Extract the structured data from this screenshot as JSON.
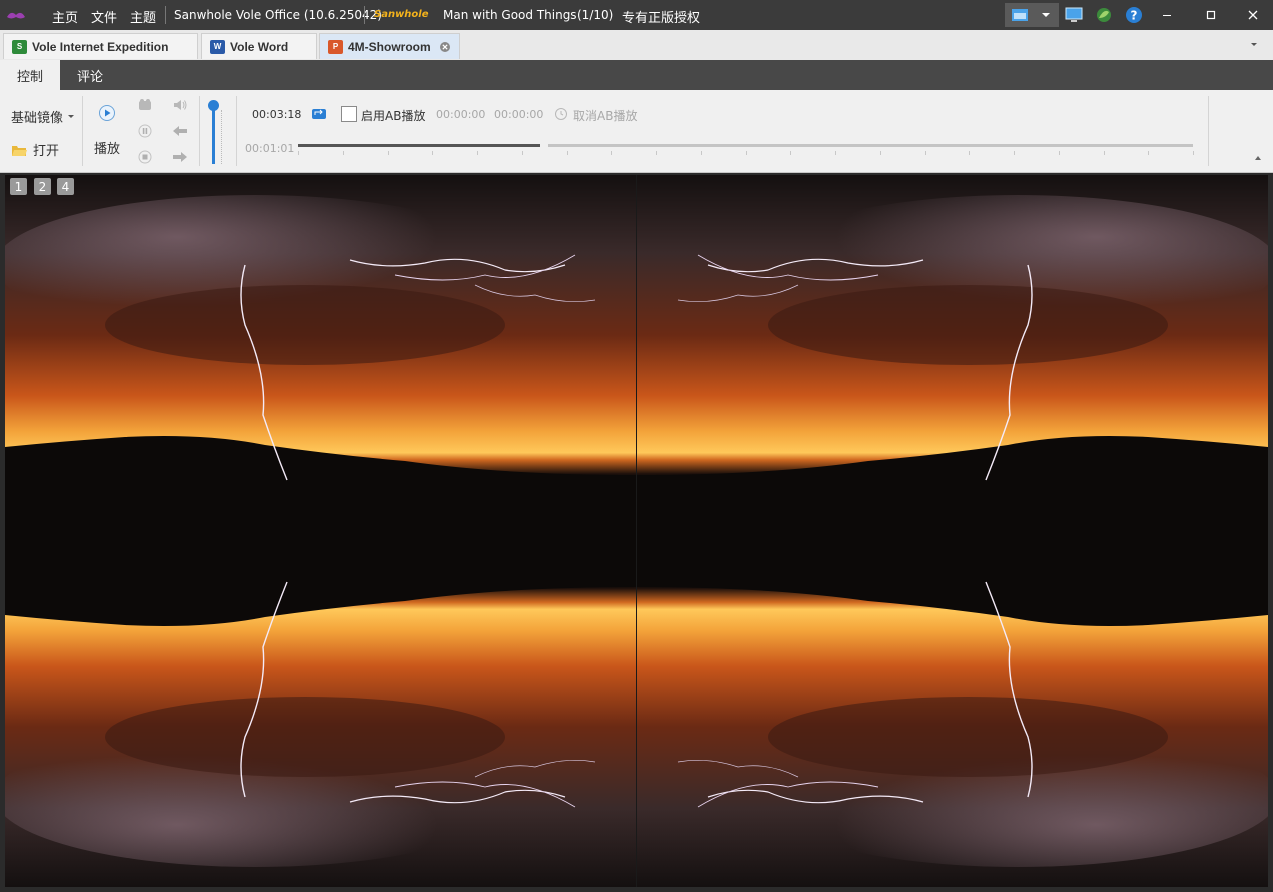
{
  "titlebar": {
    "menu": [
      "主页",
      "文件",
      "主题"
    ],
    "app_title": "Sanwhole Vole Office (10.6.25042)",
    "brand": "Sanwhole",
    "doc_title": "Man with Good Things",
    "page_counter": "(1/10)",
    "license": "专有正版授权"
  },
  "tabs": [
    {
      "label": "Vole Internet Expedition",
      "icon": "spreadsheet-icon",
      "color": "#2e8b3a"
    },
    {
      "label": "Vole Word",
      "icon": "word-doc-icon",
      "color": "#2a5aa8"
    },
    {
      "label": "4M-Showroom",
      "icon": "presentation-icon",
      "color": "#d9582b",
      "active": true
    }
  ],
  "ribbon_tabs": [
    "控制",
    "评论"
  ],
  "ribbon": {
    "mirror_label": "基础镜像",
    "open_label": "打开",
    "play_label": "播放",
    "current_time": "00:03:18",
    "ab_checkbox_label": "启用AB播放",
    "ab_start": "00:00:00",
    "ab_end": "00:00:00",
    "cancel_ab_label": "取消AB播放",
    "elapsed": "00:01:01",
    "volume_level": 0.95,
    "progress": 0.27
  },
  "view": {
    "layout_buttons": [
      "1",
      "2",
      "4"
    ]
  },
  "colors": {
    "accent": "#2a7fd4",
    "titlebar": "#3b3b3b",
    "ribbon_tab_bar": "#484848"
  }
}
